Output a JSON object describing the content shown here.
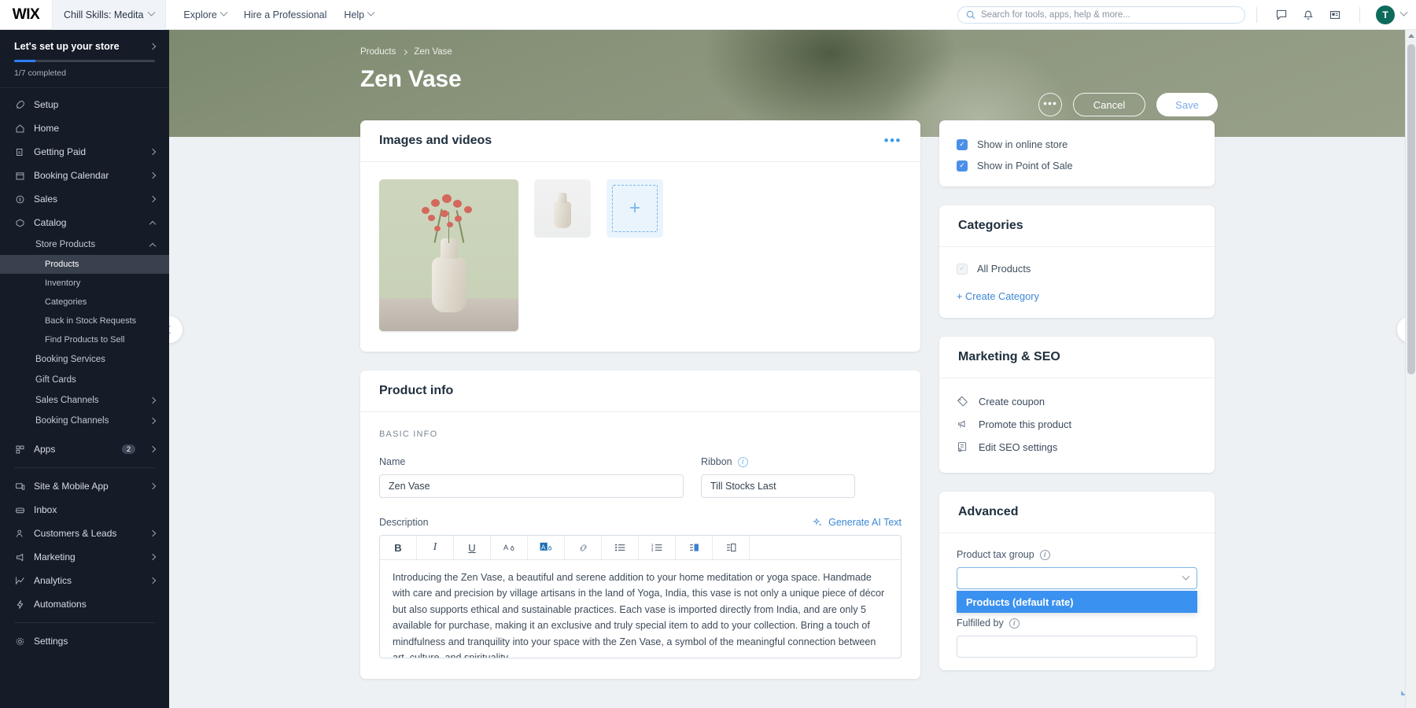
{
  "topbar": {
    "logo": "WIX",
    "site_name": "Chill Skills: Medita",
    "nav": [
      {
        "label": "Explore",
        "has_caret": true
      },
      {
        "label": "Hire a Professional",
        "has_caret": false
      },
      {
        "label": "Help",
        "has_caret": true
      }
    ],
    "search_placeholder": "Search for tools, apps, help & more...",
    "icons": [
      "chat-icon",
      "bell-icon",
      "news-icon"
    ],
    "avatar_initial": "T"
  },
  "sidebar": {
    "setup": {
      "title": "Let's set up your store",
      "progress_label": "1/7 completed",
      "progress_percent": 15
    },
    "items": [
      {
        "label": "Setup",
        "icon": "rocket-icon",
        "arrow": ""
      },
      {
        "label": "Home",
        "icon": "home-icon",
        "arrow": ""
      },
      {
        "label": "Getting Paid",
        "icon": "money-icon",
        "arrow": "right"
      },
      {
        "label": "Booking Calendar",
        "icon": "calendar-icon",
        "arrow": "right"
      },
      {
        "label": "Sales",
        "icon": "dollar-icon",
        "arrow": "right"
      },
      {
        "label": "Catalog",
        "icon": "catalog-icon",
        "arrow": "up"
      }
    ],
    "catalog_children": [
      {
        "label": "Store Products",
        "arrow": "up",
        "level": 1
      },
      {
        "label": "Products",
        "arrow": "",
        "level": 2,
        "active": true
      },
      {
        "label": "Inventory",
        "arrow": "",
        "level": 2,
        "active": false
      },
      {
        "label": "Categories",
        "arrow": "",
        "level": 2,
        "active": false
      },
      {
        "label": "Back in Stock Requests",
        "arrow": "",
        "level": 2,
        "active": false
      },
      {
        "label": "Find Products to Sell",
        "arrow": "",
        "level": 2,
        "active": false
      },
      {
        "label": "Booking Services",
        "arrow": "",
        "level": 1
      },
      {
        "label": "Gift Cards",
        "arrow": "",
        "level": 1
      },
      {
        "label": "Sales Channels",
        "arrow": "right",
        "level": 1
      },
      {
        "label": "Booking Channels",
        "arrow": "right",
        "level": 1
      }
    ],
    "apps": {
      "label": "Apps",
      "icon": "apps-icon",
      "badge": "2",
      "arrow": "right"
    },
    "items_bottom": [
      {
        "label": "Site & Mobile App",
        "icon": "monitor-icon",
        "arrow": "right"
      },
      {
        "label": "Inbox",
        "icon": "inbox-icon",
        "arrow": ""
      },
      {
        "label": "Customers & Leads",
        "icon": "people-icon",
        "arrow": "right"
      },
      {
        "label": "Marketing",
        "icon": "megaphone-icon",
        "arrow": "right"
      },
      {
        "label": "Analytics",
        "icon": "chart-icon",
        "arrow": "right"
      },
      {
        "label": "Automations",
        "icon": "bolt-icon",
        "arrow": ""
      }
    ],
    "settings": {
      "label": "Settings",
      "icon": "gear-icon"
    }
  },
  "hero": {
    "breadcrumb": [
      "Products",
      "Zen Vase"
    ],
    "title": "Zen Vase",
    "more_label": "•••",
    "cancel_label": "Cancel",
    "save_label": "Save"
  },
  "media_card": {
    "title": "Images and videos",
    "add_label": "+"
  },
  "product_info": {
    "title": "Product info",
    "section_label": "BASIC INFO",
    "name_label": "Name",
    "name_value": "Zen Vase",
    "ribbon_label": "Ribbon",
    "ribbon_value": "Till Stocks Last",
    "description_label": "Description",
    "ai_label": "Generate AI Text",
    "toolbar": [
      {
        "name": "bold-icon",
        "glyph": "B",
        "active": false
      },
      {
        "name": "italic-icon",
        "glyph": "I",
        "active": false
      },
      {
        "name": "underline-icon",
        "glyph": "U",
        "active": false
      },
      {
        "name": "text-color-icon",
        "glyph": "A",
        "active": false
      },
      {
        "name": "highlight-color-icon",
        "glyph": "A",
        "active": true
      },
      {
        "name": "link-icon",
        "glyph": "🔗",
        "active": false
      },
      {
        "name": "bullet-list-icon",
        "glyph": "☰",
        "active": false
      },
      {
        "name": "numbered-list-icon",
        "glyph": "≡",
        "active": false
      },
      {
        "name": "align-right-icon",
        "glyph": "◧",
        "active": false
      },
      {
        "name": "text-direction-icon",
        "glyph": "◨",
        "active": false
      }
    ],
    "description_text": "Introducing the Zen Vase, a beautiful and serene addition to your home meditation or yoga space. Handmade with care and precision by village artisans in the land of Yoga, India, this vase is not only a unique piece of décor but also supports ethical and sustainable practices. Each vase is imported directly from India, and are only 5 available for purchase, making it an exclusive and truly special item to add to your collection. Bring a touch of mindfulness and tranquility into your space with the Zen Vase, a symbol of the meaningful connection between art, culture, and spirituality."
  },
  "visibility": {
    "options": [
      {
        "label": "Show in online store",
        "checked": true,
        "disabled": false
      },
      {
        "label": "Show in Point of Sale",
        "checked": true,
        "disabled": false
      }
    ]
  },
  "categories": {
    "title": "Categories",
    "items": [
      {
        "label": "All Products",
        "checked": true,
        "disabled": true
      }
    ],
    "create_label": "+ Create Category"
  },
  "marketing": {
    "title": "Marketing & SEO",
    "links": [
      {
        "label": "Create coupon",
        "icon": "coupon-icon"
      },
      {
        "label": "Promote this product",
        "icon": "megaphone-icon"
      },
      {
        "label": "Edit SEO settings",
        "icon": "seo-icon"
      }
    ]
  },
  "advanced": {
    "title": "Advanced",
    "tax_label": "Product tax group",
    "tax_value": "",
    "tax_options": [
      "Products (default rate)"
    ],
    "fulfilled_label": "Fulfilled by",
    "fulfilled_value": ""
  },
  "colors": {
    "accent_blue": "#3b87d6",
    "hero_green": "#8b957c",
    "sidebar_dark": "#151c28",
    "dropdown_highlight": "#3b91ef",
    "avatar_green": "#0e6b5c"
  }
}
